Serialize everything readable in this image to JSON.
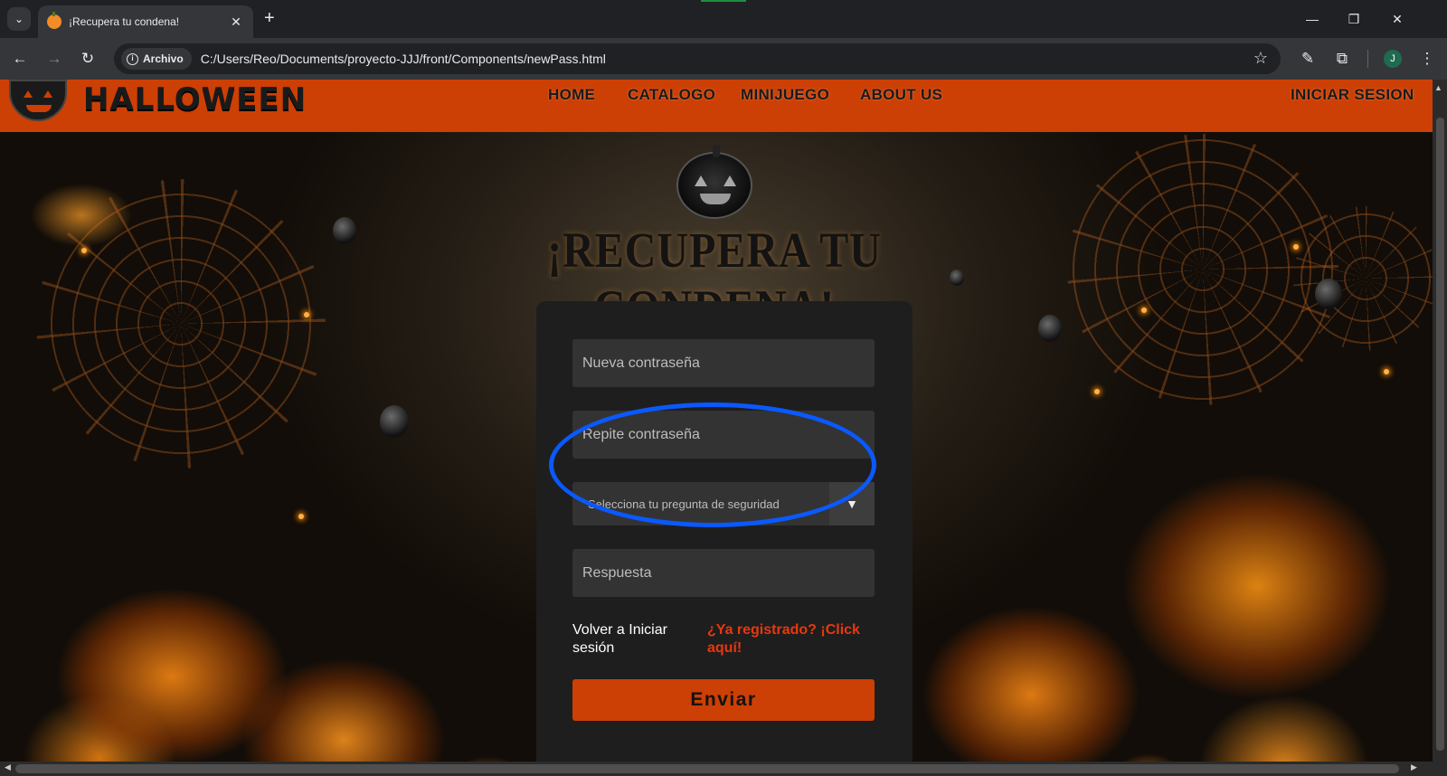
{
  "browser": {
    "tab_title": "¡Recupera tu condena!",
    "tab_close": "✕",
    "new_tab": "+",
    "site_chip": "Archivo",
    "url": "C:/Users/Reo/Documents/proyecto-JJJ/front/Components/newPass.html",
    "profile_initial": "J",
    "window_controls": [
      "minimize-icon",
      "restore-icon",
      "close-icon"
    ]
  },
  "header": {
    "logo_text": "HALLOWEEN",
    "nav": [
      "HOME",
      "CATALOGO",
      "MINIJUEGO",
      "ABOUT US"
    ],
    "login": "INICIAR SESION"
  },
  "page": {
    "title": "¡RECUPERA TU CONDENA!"
  },
  "form": {
    "new_password_placeholder": "Nueva contraseña",
    "repeat_password_placeholder": "Repite contraseña",
    "security_question_selected": "Selecciona tu pregunta de seguridad",
    "answer_placeholder": "Respuesta",
    "back_link": "Volver a Iniciar sesión",
    "register_link": "¿Ya registrado? ¡Click aquí!",
    "submit_label": "Enviar"
  },
  "colors": {
    "header_bg": "#cc3f05",
    "card_bg": "#1e1e1e",
    "input_bg": "#333333",
    "link_accent": "#e8380d",
    "annotation": "#0a59ff"
  }
}
